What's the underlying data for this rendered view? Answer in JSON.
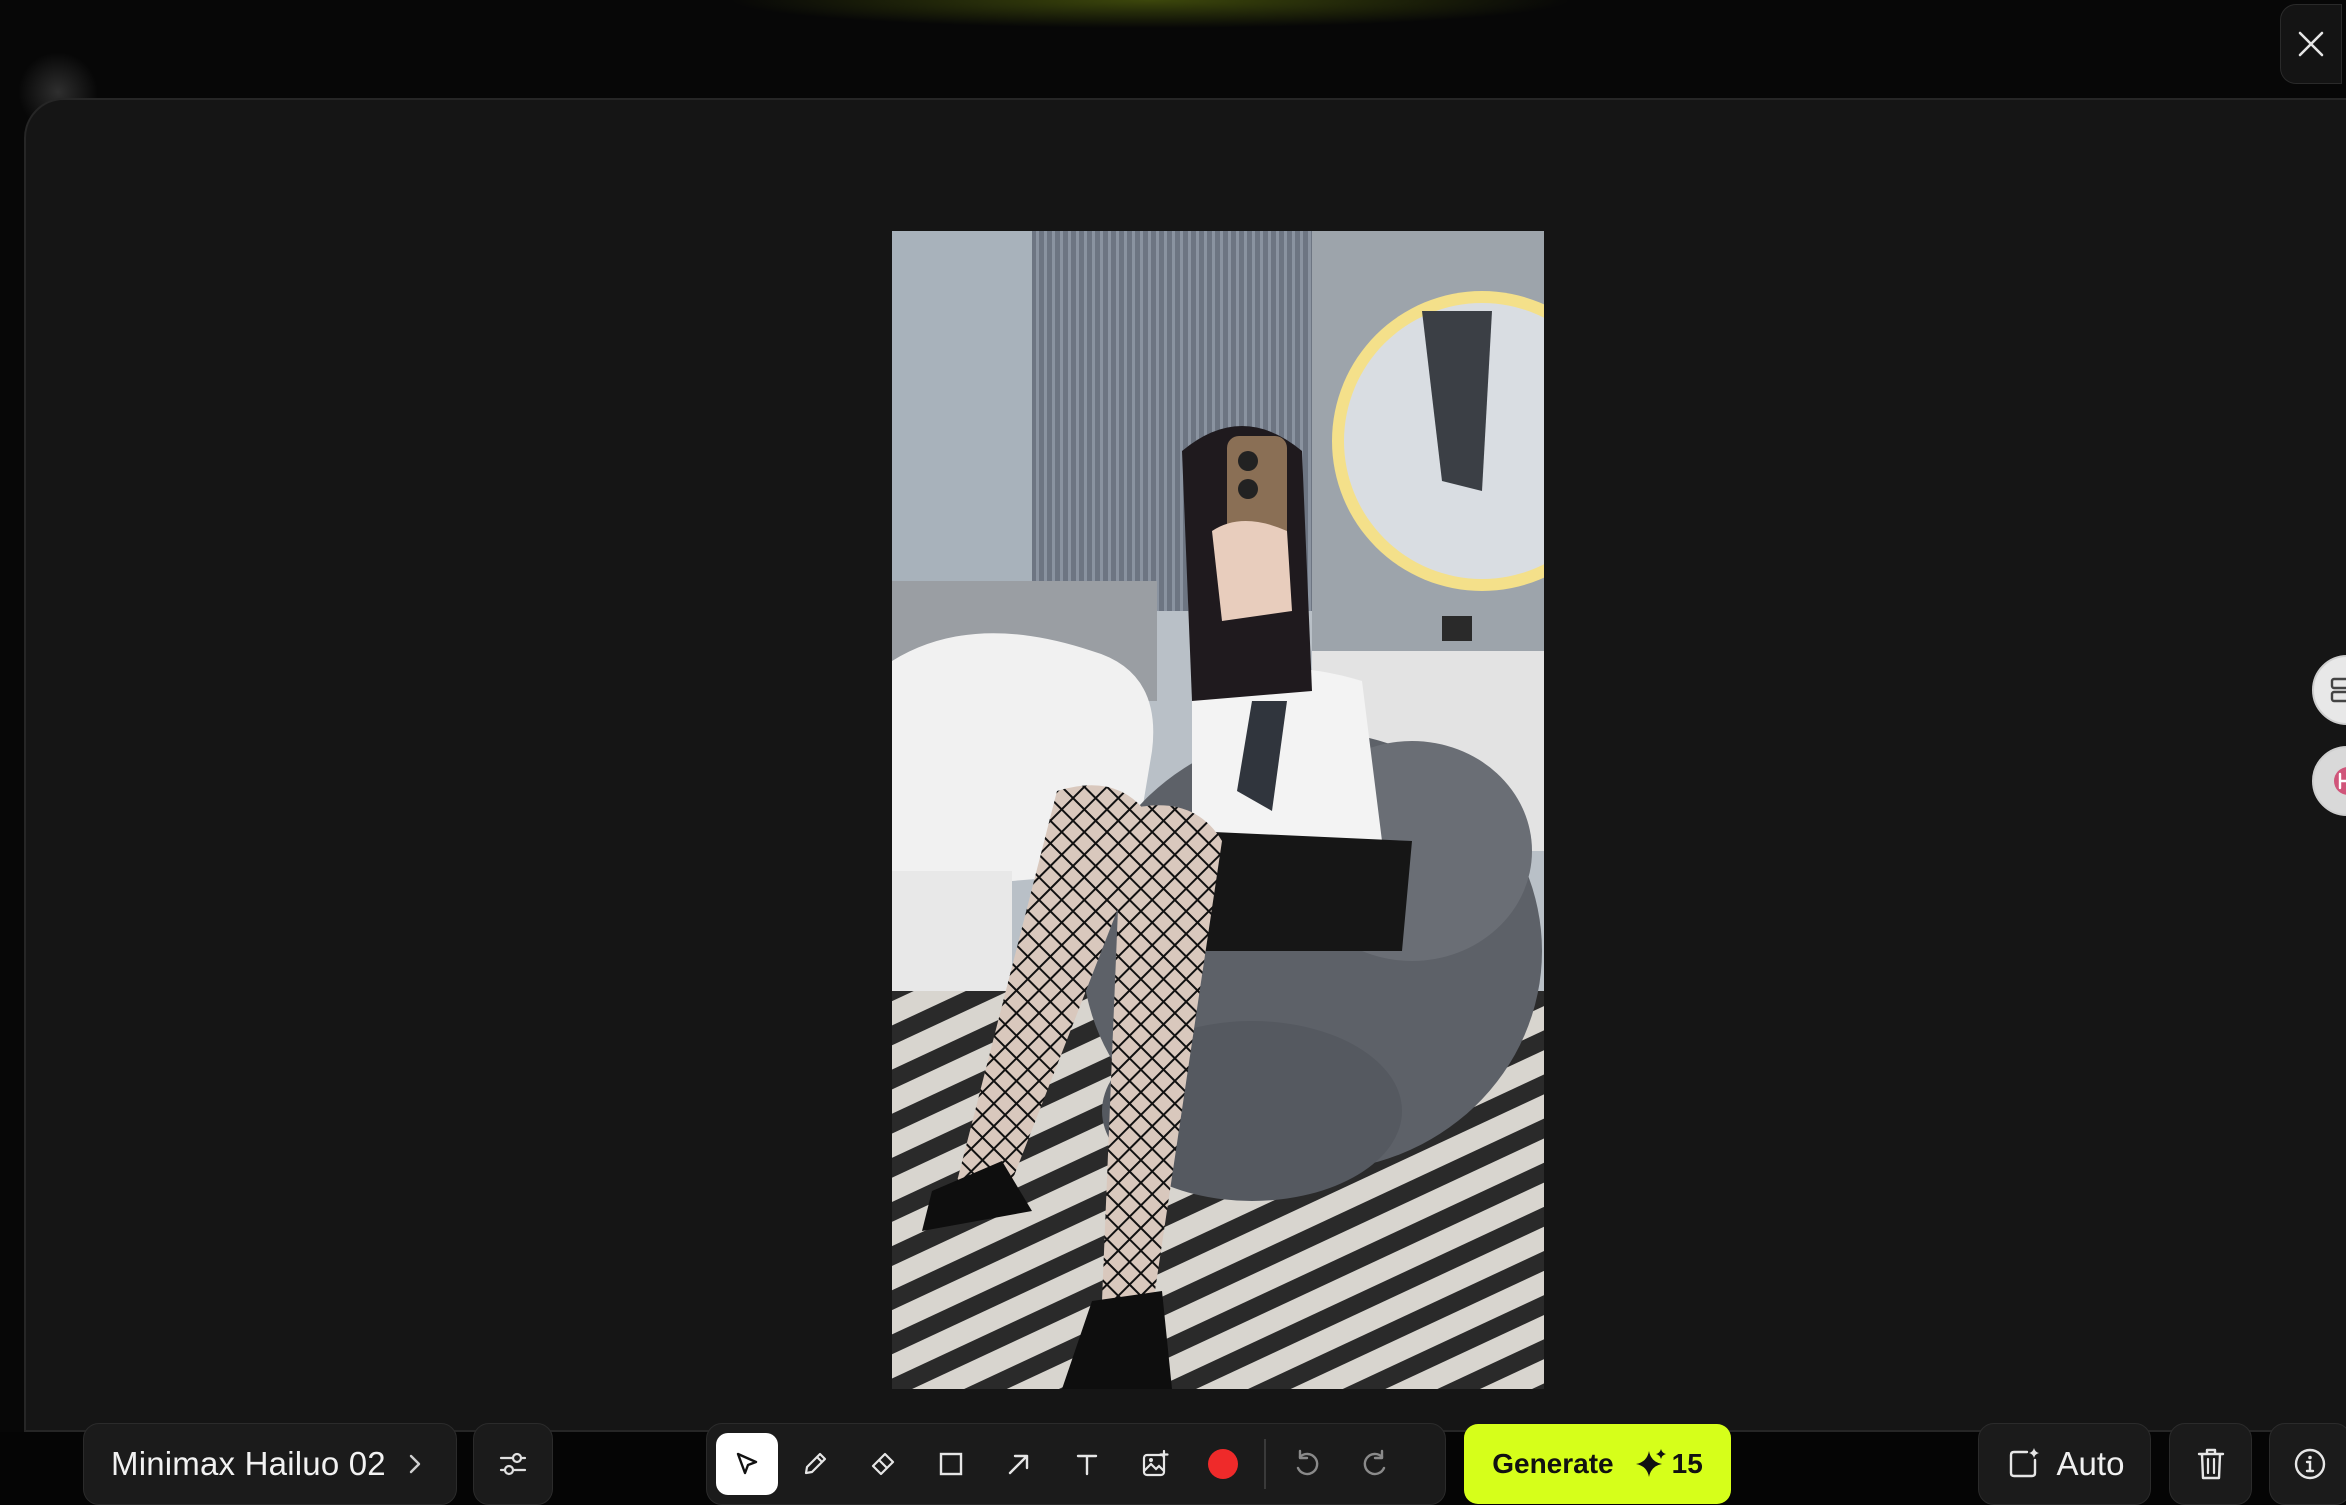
{
  "window": {
    "close_icon": "close-icon"
  },
  "footer": {
    "model_name": "Minimax Hailuo 02",
    "model_chevron_icon": "chevron-right-icon",
    "settings_icon": "sliders-icon",
    "tools": [
      {
        "name": "select",
        "icon": "cursor-arrow-icon",
        "active": true
      },
      {
        "name": "pen",
        "icon": "pencil-icon",
        "active": false
      },
      {
        "name": "eraser",
        "icon": "eraser-icon",
        "active": false
      },
      {
        "name": "rectangle",
        "icon": "square-icon",
        "active": false
      },
      {
        "name": "arrow",
        "icon": "arrow-up-right-icon",
        "active": false
      },
      {
        "name": "text",
        "icon": "text-icon",
        "active": false
      },
      {
        "name": "image",
        "icon": "image-plus-icon",
        "active": false
      }
    ],
    "brush_color": "#ef2a2a",
    "undo_icon": "undo-icon",
    "redo_icon": "redo-icon",
    "generate_label": "Generate",
    "generate_cost": "15",
    "generate_icon": "sparkle-icon",
    "generate_color": "#d6ff1a",
    "aspect_label": "Auto",
    "aspect_icon": "aspect-ratio-icon",
    "delete_icon": "trash-icon",
    "info_icon": "info-icon"
  },
  "canvas": {
    "content": "photo"
  }
}
